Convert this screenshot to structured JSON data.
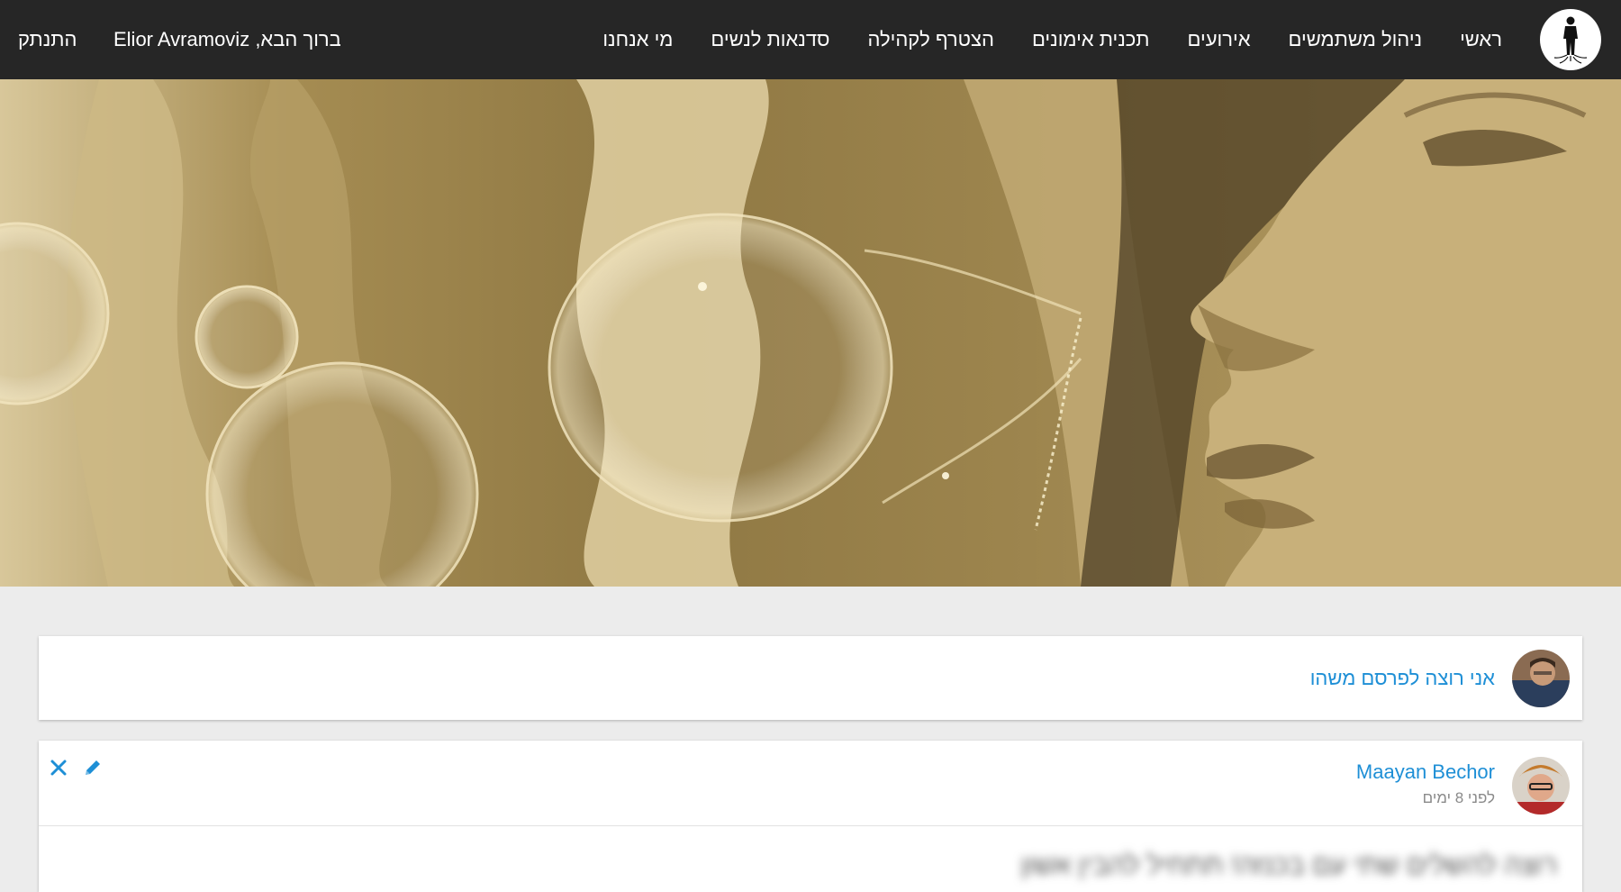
{
  "nav": {
    "items": [
      {
        "label": "ראשי"
      },
      {
        "label": "ניהול משתמשים"
      },
      {
        "label": "אירועים"
      },
      {
        "label": "תכנית אימונים"
      },
      {
        "label": "הצטרף לקהילה"
      },
      {
        "label": "סדנאות לנשים"
      },
      {
        "label": "מי אנחנו"
      }
    ],
    "welcome": "ברוך הבא, Elior Avramoviz",
    "logout": "התנתק"
  },
  "composer": {
    "prompt": "אני רוצה לפרסם משהו"
  },
  "post": {
    "author": "Maayan Bechor",
    "time": "לפני 8 ימים",
    "body": "רוצה להשלים שתי עם בכנזה! תתחיל להבין אשון"
  },
  "colors": {
    "navbar": "#262626",
    "link": "#1e8fd6",
    "background": "#ececec",
    "hero_tint": "#a68d52"
  },
  "icons": {
    "logo": "silhouette-logo-icon",
    "edit": "pencil-icon",
    "delete": "close-icon"
  }
}
